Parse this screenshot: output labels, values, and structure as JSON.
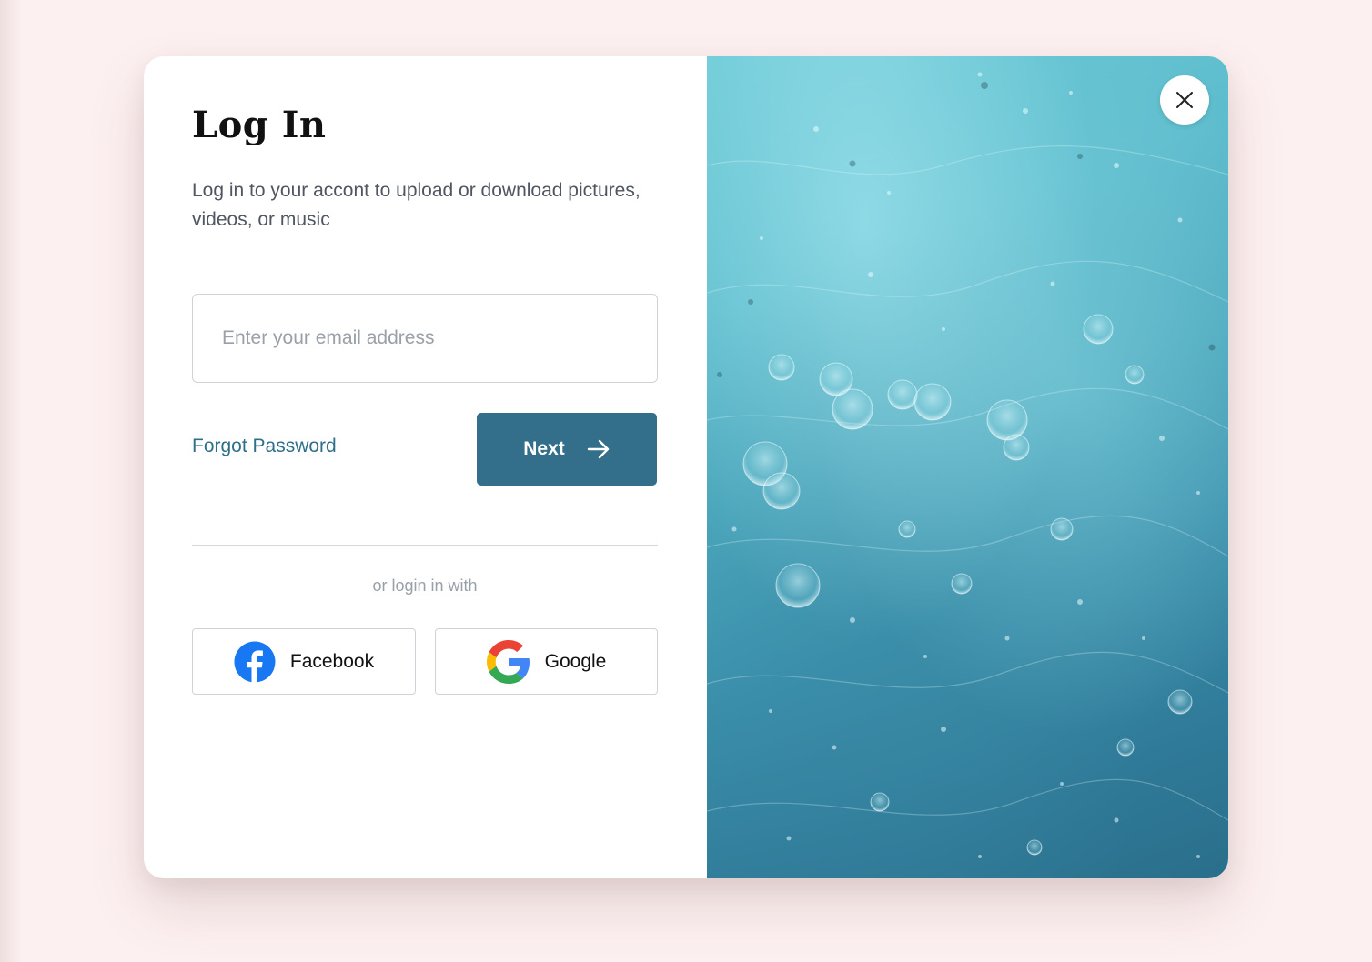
{
  "login": {
    "title": "Log In",
    "subtitle": "Log in to your accont to upload or download pictures, videos, or music",
    "email_placeholder": "Enter your email address",
    "email_value": "",
    "forgot_password": "Forgot Password",
    "next_label": "Next",
    "alt_login_label": "or login in with",
    "facebook_label": "Facebook",
    "google_label": "Google"
  },
  "icons": {
    "next": "arrow-right-icon",
    "facebook": "facebook-logo-icon",
    "google": "google-logo-icon",
    "close": "close-icon"
  },
  "colors": {
    "accent": "#336f8a",
    "link": "#2f6f8a",
    "background": "#fdf0f0",
    "facebook": "#1877f2"
  }
}
